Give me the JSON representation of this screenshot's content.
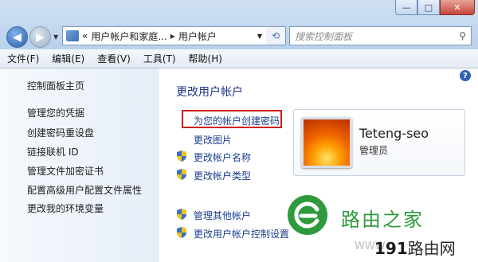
{
  "window": {
    "minimize_icon": "minimize-icon",
    "maximize_icon": "maximize-icon",
    "close_icon": "close-icon",
    "min_glyph": "—",
    "max_glyph": "□",
    "close_glyph": "✕"
  },
  "address": {
    "chevron": "«",
    "crumb1": "用户帐户和家庭...",
    "sep": "▸",
    "crumb2": "用户帐户"
  },
  "search": {
    "placeholder": "搜索控制面板"
  },
  "menu": [
    "文件(F)",
    "编辑(E)",
    "查看(V)",
    "工具(T)",
    "帮助(H)"
  ],
  "sidebar": {
    "items": [
      "控制面板主页",
      "管理您的凭据",
      "创建密码重设盘",
      "链接联机 ID",
      "管理文件加密证书",
      "配置高级用户配置文件属性",
      "更改我的环境变量"
    ]
  },
  "main": {
    "title": "更改用户帐户",
    "links": [
      "为您的帐户创建密码",
      "更改图片",
      "更改帐户名称",
      "更改帐户类型"
    ],
    "links2": [
      "管理其他帐户",
      "更改用户帐户控制设置"
    ]
  },
  "user": {
    "name": "Teteng-seo",
    "role": "管理员"
  },
  "watermark": {
    "brand": "路由之家",
    "site_prefix": "191",
    "site_suffix": "路由网",
    "faint": "WWW"
  },
  "colors": {
    "link": "#1a3f8e",
    "highlight": "#d01c1c",
    "brand_green": "#2e9a3c"
  }
}
